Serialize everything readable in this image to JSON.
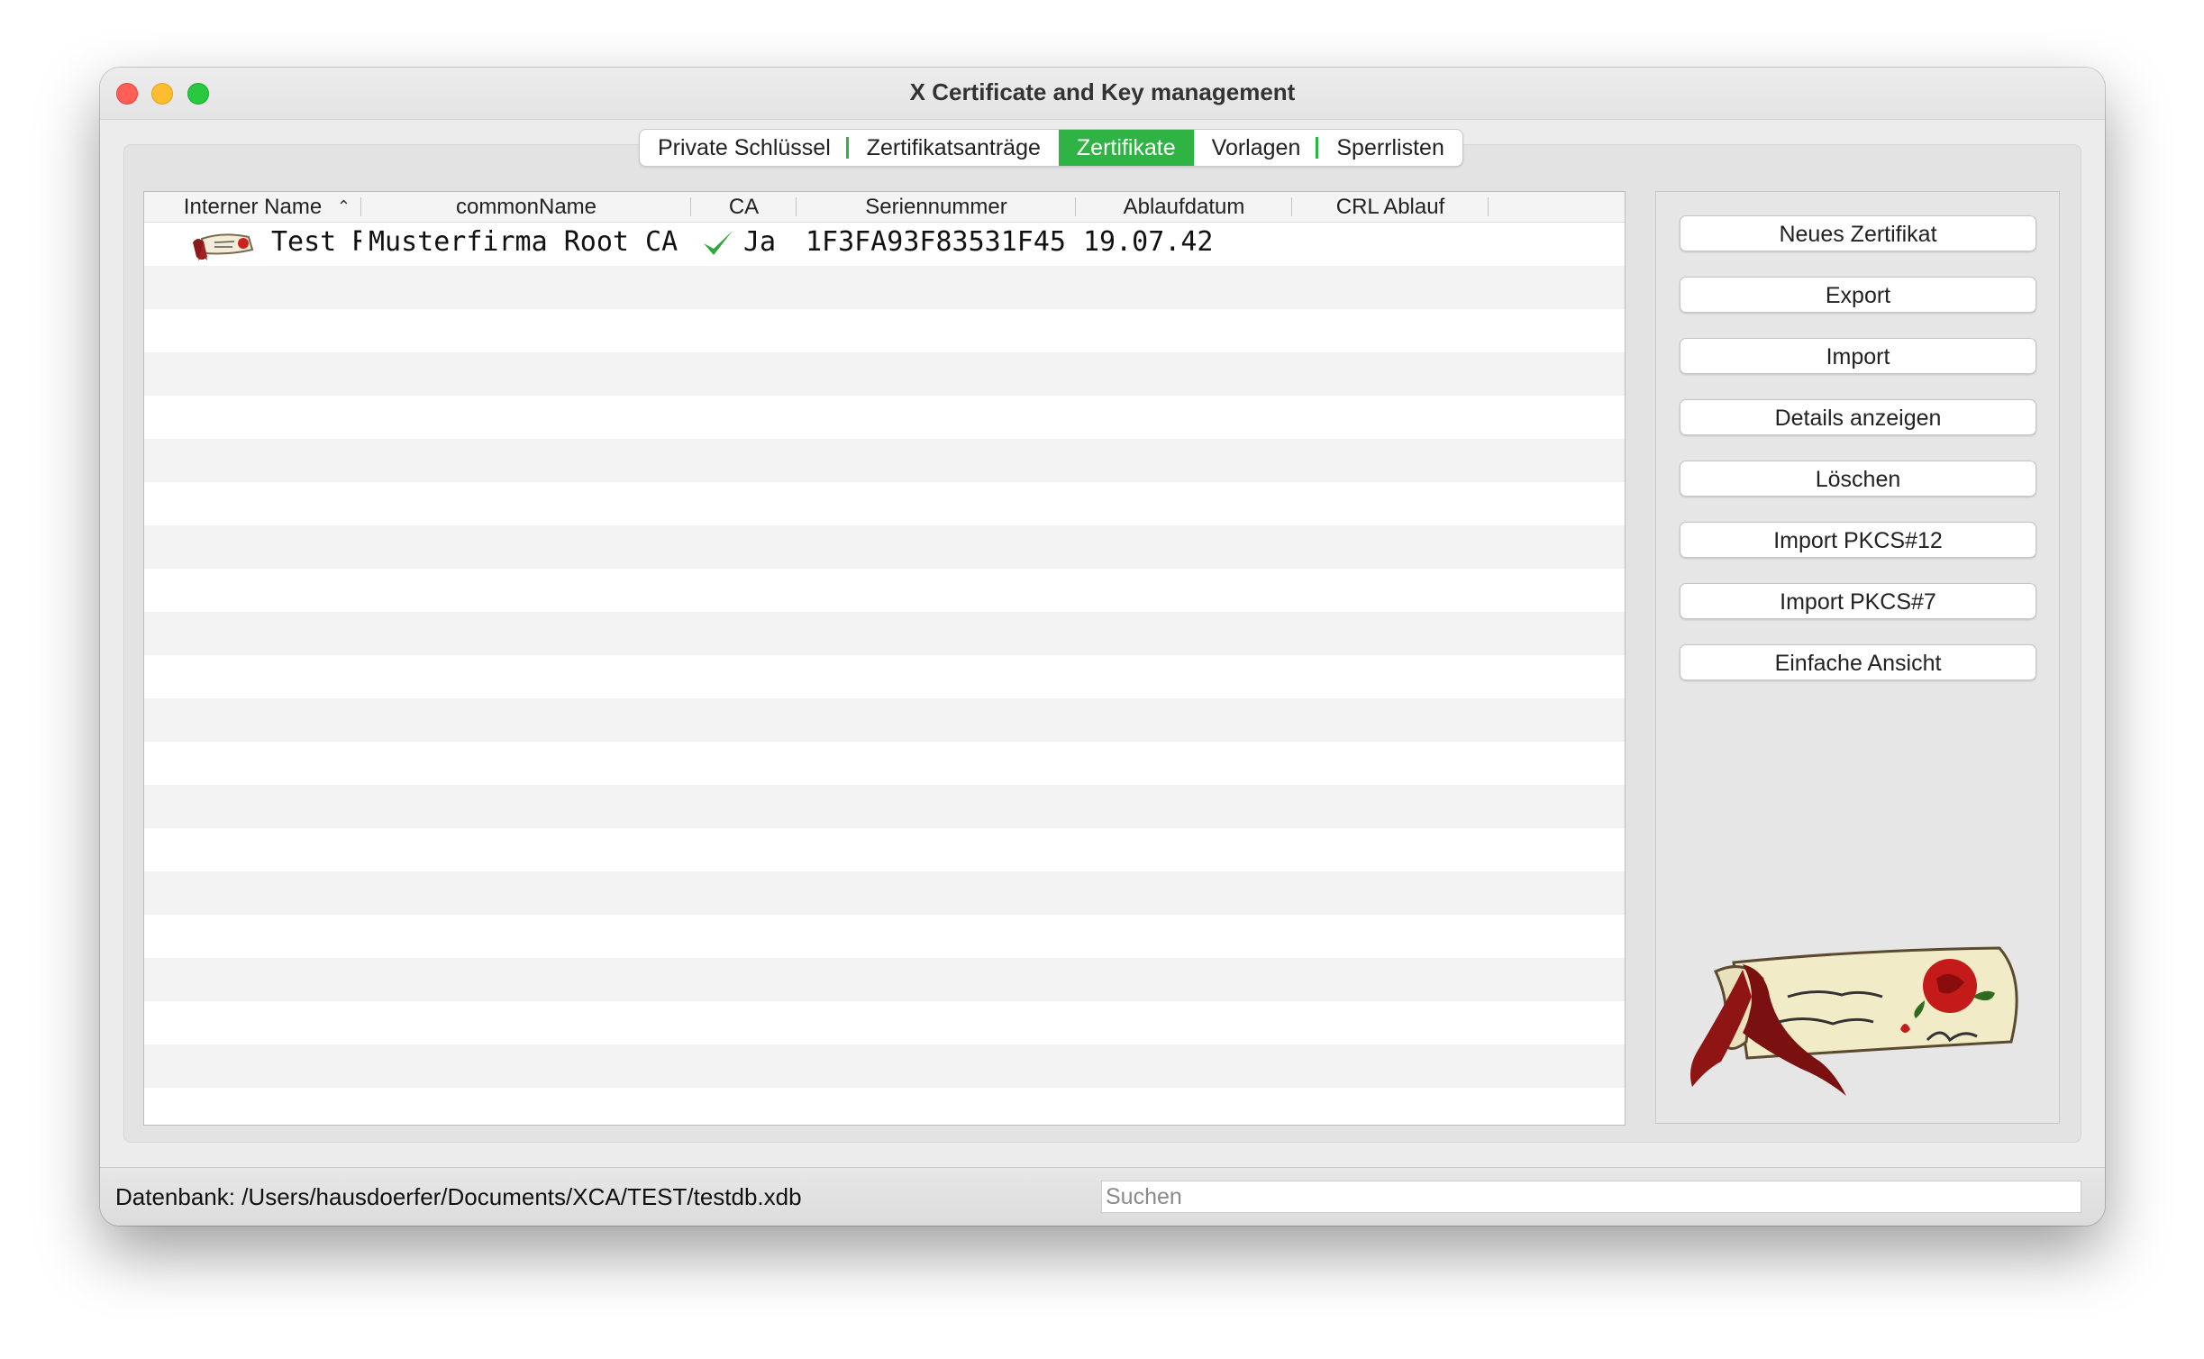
{
  "window": {
    "title": "X Certificate and Key management"
  },
  "tabs": [
    {
      "label": "Private Schlüssel",
      "active": false
    },
    {
      "label": "Zertifikatsanträge",
      "active": false
    },
    {
      "label": "Zertifikate",
      "active": true
    },
    {
      "label": "Vorlagen",
      "active": false
    },
    {
      "label": "Sperrlisten",
      "active": false
    }
  ],
  "table": {
    "columns": [
      "Interner Name",
      "commonName",
      "CA",
      "Seriennummer",
      "Ablaufdatum",
      "CRL Ablauf"
    ],
    "sort_column": "Interner Name",
    "rows": [
      {
        "icon": "certificate-icon",
        "internal_name": "Test Root CA",
        "common_name": "Musterfirma Root CA",
        "ca": "Ja",
        "ca_icon": "checkmark-icon",
        "serial": "1F3FA93F83531F45",
        "expiry": "19.07.42",
        "crl_expiry": ""
      }
    ]
  },
  "sidebar": {
    "buttons": [
      "Neues Zertifikat",
      "Export",
      "Import",
      "Details anzeigen",
      "Löschen",
      "Import PKCS#12",
      "Import PKCS#7",
      "Einfache Ansicht"
    ],
    "logo": "scroll-rose-logo-icon"
  },
  "status": {
    "database": "Datenbank: /Users/hausdoerfer/Documents/XCA/TEST/testdb.xdb"
  },
  "search": {
    "placeholder": "Suchen",
    "value": ""
  },
  "colors": {
    "accent": "#2fb344",
    "traffic_red": "#ff5f57",
    "traffic_yellow": "#febc2e",
    "traffic_green": "#28c840"
  }
}
